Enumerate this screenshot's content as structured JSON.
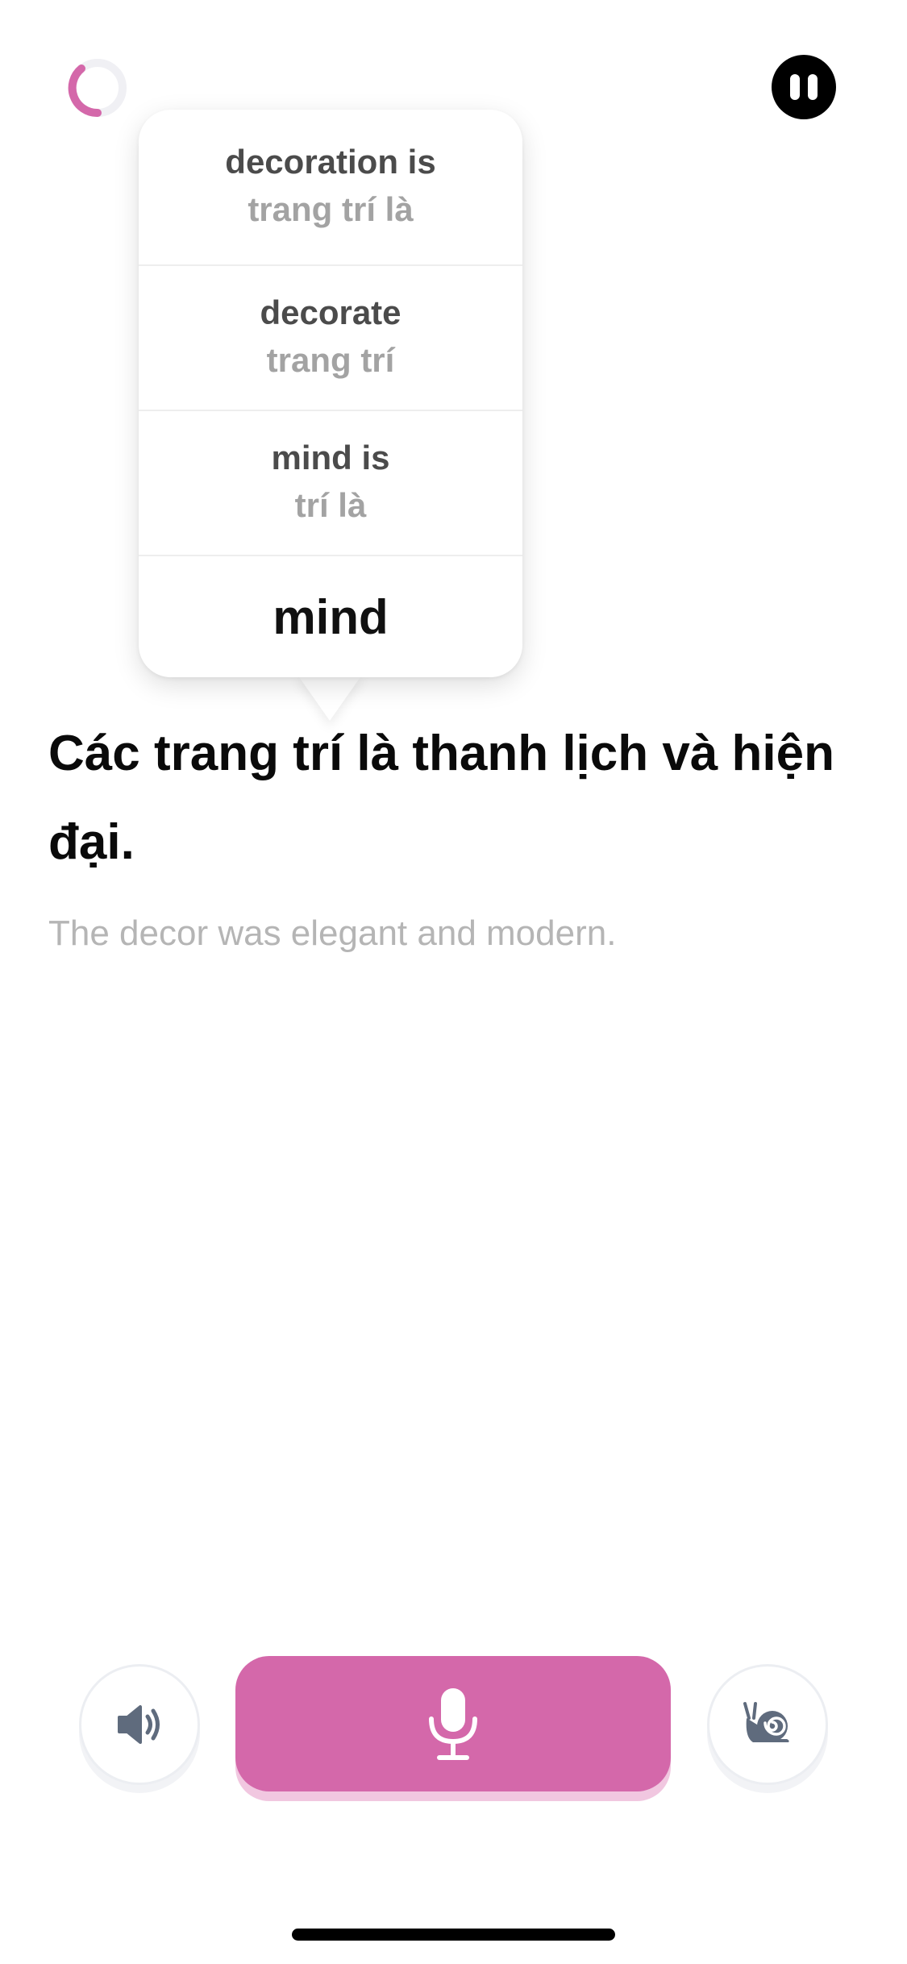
{
  "header": {
    "progress_icon": "circular-progress-ring",
    "pause_icon": "pause-icon"
  },
  "popup": {
    "options": [
      {
        "text": "decoration is",
        "translation": "trang trí là"
      },
      {
        "text": "decorate",
        "translation": "trang trí"
      },
      {
        "text": "mind is",
        "translation": "trí là"
      },
      {
        "text": "mind"
      }
    ]
  },
  "lesson": {
    "sentence": "Các trang trí là thanh lịch và hiện đại.",
    "translation": "The decor was elegant and modern."
  },
  "controls": {
    "speaker_icon": "speaker-icon",
    "mic_icon": "microphone-icon",
    "slow_icon": "snail-icon"
  },
  "colors": {
    "accent": "#d468aa",
    "accent_shadow": "#f1c7e0",
    "icon_gray": "#5f6b7d"
  }
}
